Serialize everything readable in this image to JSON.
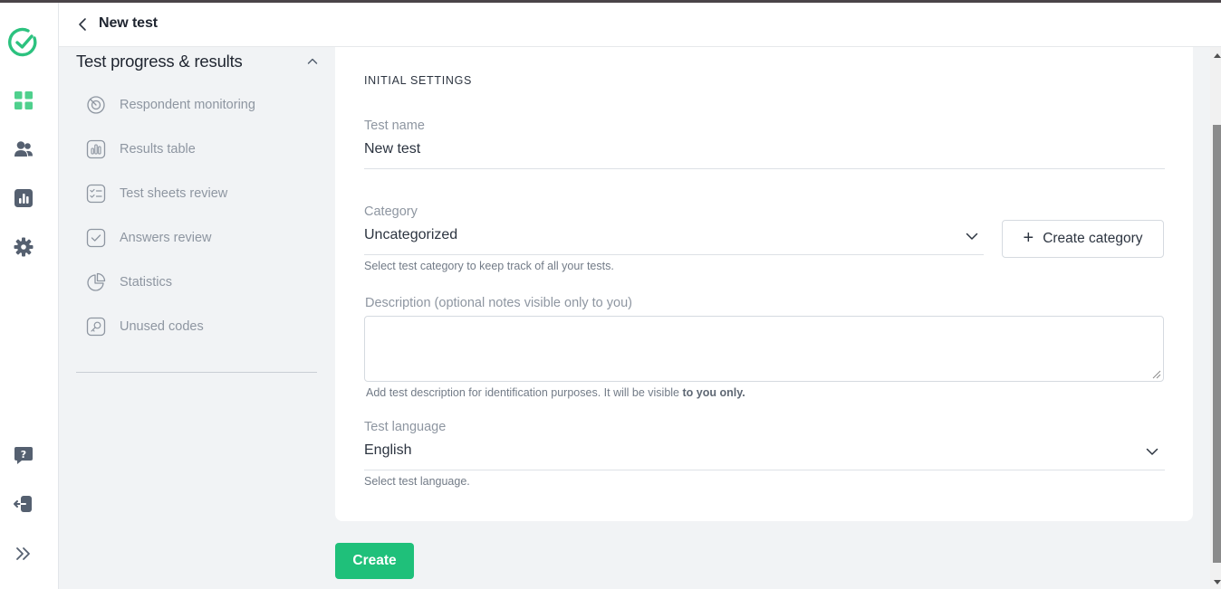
{
  "header": {
    "title": "New test",
    "back_icon": "chevron-left-icon"
  },
  "rail": {
    "items": [
      {
        "icon": "logo-check-circle-icon",
        "color": "#2cc27f"
      },
      {
        "icon": "dashboard-grid-icon",
        "color": "#4fd08d"
      },
      {
        "icon": "users-icon"
      },
      {
        "icon": "bar-chart-icon"
      },
      {
        "icon": "gear-icon"
      },
      {
        "icon": "help-chat-icon"
      },
      {
        "icon": "logout-icon"
      },
      {
        "icon": "expand-double-chevron-icon"
      }
    ]
  },
  "subnav": {
    "title": "Test progress & results",
    "items": [
      {
        "label": "Respondent monitoring",
        "icon": "radar-icon"
      },
      {
        "label": "Results table",
        "icon": "bars-table-icon"
      },
      {
        "label": "Test sheets review",
        "icon": "checklist-icon"
      },
      {
        "label": "Answers review",
        "icon": "checkbox-icon"
      },
      {
        "label": "Statistics",
        "icon": "pie-chart-icon"
      },
      {
        "label": "Unused codes",
        "icon": "key-icon"
      }
    ]
  },
  "form": {
    "section_title": "INITIAL SETTINGS",
    "test_name": {
      "label": "Test name",
      "value": "New test"
    },
    "category": {
      "label": "Category",
      "value": "Uncategorized",
      "helper": "Select test category to keep track of all your tests.",
      "create_button": "Create category"
    },
    "description": {
      "label": "Description (optional notes visible only to you)",
      "value": "",
      "helper_prefix": "Add test description for identification purposes. It will be visible ",
      "helper_bold": "to you only."
    },
    "language": {
      "label": "Test language",
      "value": "English",
      "helper": "Select test language."
    }
  },
  "actions": {
    "create_label": "Create"
  },
  "colors": {
    "accent": "#1fc07a",
    "brand": "#2cc27f",
    "muted_text": "#8e96a1"
  }
}
